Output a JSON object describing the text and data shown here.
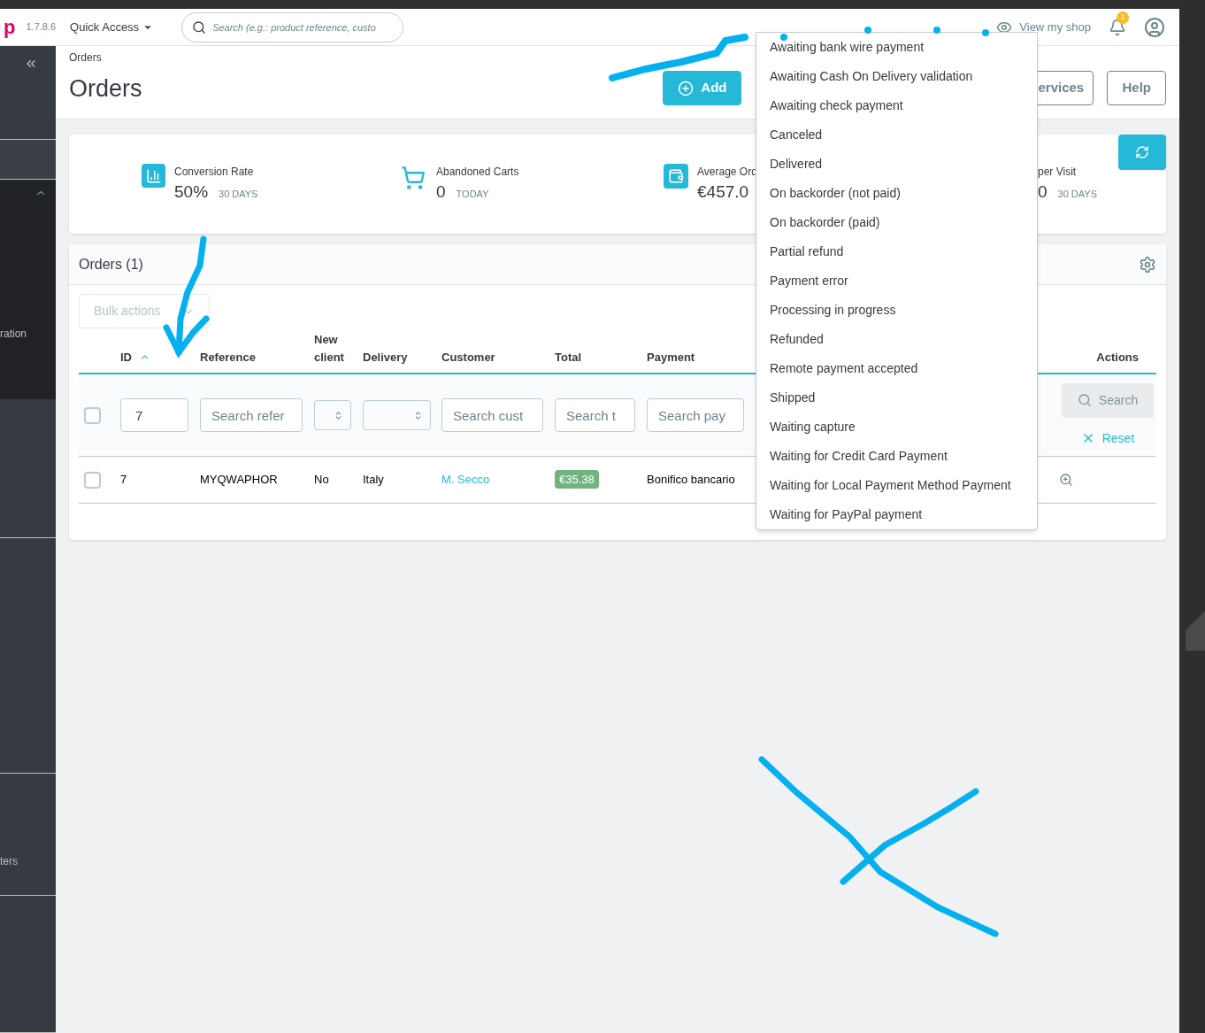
{
  "header": {
    "logo": "p",
    "version": "1.7.8.6",
    "quick_access": "Quick Access",
    "search": {
      "placeholder": "Search (e.g.: product reference, custo"
    },
    "view_shop": "View my shop",
    "notification_count": "1"
  },
  "sidebar": {
    "items": [
      {
        "kind": "collapse"
      },
      {
        "kind": "plain"
      },
      {
        "kind": "section",
        "label": "ration",
        "expanded": true
      },
      {
        "kind": "plain"
      },
      {
        "kind": "plain"
      },
      {
        "kind": "section",
        "label": "ters",
        "expanded": false
      },
      {
        "kind": "plain"
      }
    ]
  },
  "page": {
    "breadcrumb": "Orders",
    "title": "Orders",
    "buttons": [
      {
        "kind": "primary",
        "label": "Add"
      },
      {
        "kind": "outline",
        "label": "ervices"
      },
      {
        "kind": "outline",
        "label": "Help"
      }
    ]
  },
  "kpis": [
    {
      "kind": "chart",
      "label": "Conversion Rate",
      "value": "50%",
      "period": "30 DAYS"
    },
    {
      "kind": "cart",
      "label": "Abandoned Carts",
      "value": "0",
      "period": "TODAY"
    },
    {
      "kind": "wallet",
      "label": "Average Ord",
      "value": "€457.0"
    },
    {
      "kind": "none",
      "label": "per Visit",
      "value": "0",
      "period": "30 DAYS"
    }
  ],
  "panel": {
    "title": "Orders (1)",
    "bulk_actions": "Bulk actions",
    "columns": [
      {
        "label": "ID",
        "sorted": true
      },
      {
        "label": "Reference",
        "sorted": false
      },
      {
        "label": "New client",
        "sorted": false
      },
      {
        "label": "Delivery",
        "sorted": false
      },
      {
        "label": "Customer",
        "sorted": false
      },
      {
        "label": "Total",
        "sorted": false
      },
      {
        "label": "Payment",
        "sorted": false
      },
      {
        "label": "Actions",
        "sorted": false
      }
    ],
    "filters": {
      "checked": false,
      "id": "7",
      "reference": {
        "placeholder": "Search refer"
      },
      "customer": {
        "placeholder": "Search cust"
      },
      "total": {
        "placeholder": "Search t"
      },
      "payment": {
        "placeholder": "Search pay"
      },
      "search": "Search",
      "reset": "Reset"
    },
    "rows": [
      {
        "selected": false,
        "id": "7",
        "reference": "MYQWAPHOR",
        "new_client": "No",
        "delivery": "Italy",
        "customer": "M. Secco",
        "total": "€35.38",
        "payment": "Bonifico bancario"
      }
    ]
  },
  "status_dropdown": {
    "options": [
      "Awaiting bank wire payment",
      "Awaiting Cash On Delivery validation",
      "Awaiting check payment",
      "Canceled",
      "Delivered",
      "On backorder (not paid)",
      "On backorder (paid)",
      "Partial refund",
      "Payment error",
      "Processing in progress",
      "Refunded",
      "Remote payment accepted",
      "Shipped",
      "Waiting capture",
      "Waiting for Credit Card Payment",
      "Waiting for Local Payment Method Payment",
      "Waiting for PayPal payment"
    ]
  }
}
